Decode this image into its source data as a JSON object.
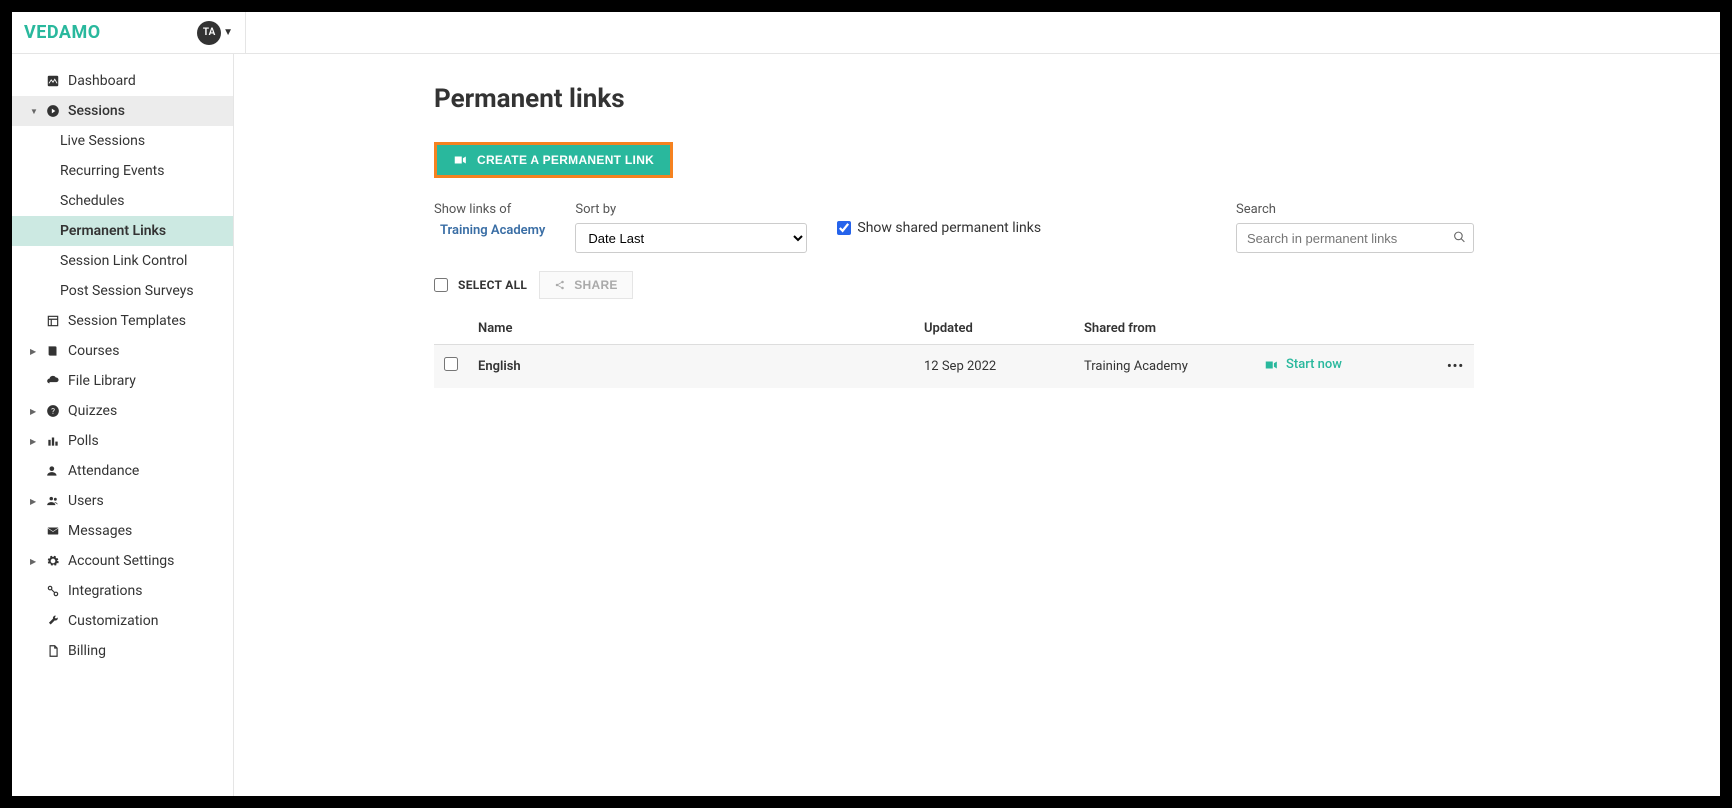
{
  "brand": "VEDAMO",
  "avatar_initials": "TA",
  "sidebar": {
    "dashboard": "Dashboard",
    "sessions": "Sessions",
    "live_sessions": "Live Sessions",
    "recurring_events": "Recurring Events",
    "schedules": "Schedules",
    "permanent_links": "Permanent Links",
    "session_link_control": "Session Link Control",
    "post_session_surveys": "Post Session Surveys",
    "session_templates": "Session Templates",
    "courses": "Courses",
    "file_library": "File Library",
    "quizzes": "Quizzes",
    "polls": "Polls",
    "attendance": "Attendance",
    "users": "Users",
    "messages": "Messages",
    "account_settings": "Account Settings",
    "integrations": "Integrations",
    "customization": "Customization",
    "billing": "Billing"
  },
  "page": {
    "title": "Permanent links",
    "create_btn": "CREATE A PERMANENT LINK",
    "filters": {
      "show_links_label": "Show links of",
      "show_links_value": "Training Academy",
      "sort_label": "Sort by",
      "sort_value": "Date Last",
      "shared_checkbox_label": "Show shared permanent links",
      "shared_checkbox_checked": true,
      "search_label": "Search",
      "search_placeholder": "Search in permanent links"
    },
    "actions": {
      "select_all": "SELECT ALL",
      "share": "SHARE"
    },
    "table": {
      "headers": {
        "name": "Name",
        "updated": "Updated",
        "shared_from": "Shared from"
      },
      "rows": [
        {
          "name": "English",
          "updated": "12 Sep 2022",
          "shared_from": "Training Academy",
          "action": "Start now"
        }
      ]
    }
  }
}
